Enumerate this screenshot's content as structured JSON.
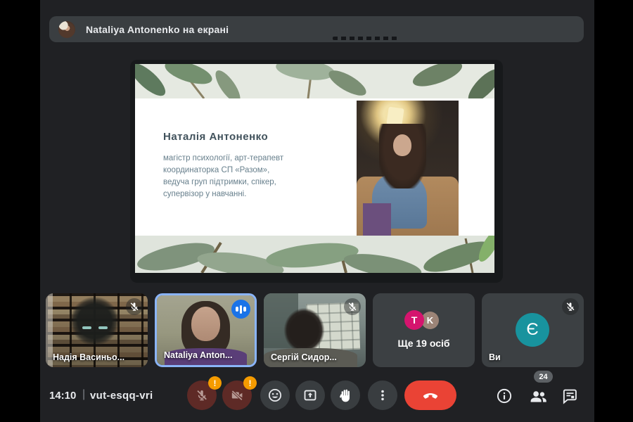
{
  "banner": {
    "text": "Nataliya Antonenko на екрані"
  },
  "slide": {
    "title": "Наталія Антоненко",
    "body_lines": [
      "магістр психології, арт-терапевт",
      "координаторка СП «Разом»,",
      "ведуча груп підтримки, спікер,",
      "супервізор у навчанні."
    ]
  },
  "tiles": [
    {
      "label": "Надія Васиньо...",
      "muted": true
    },
    {
      "label": "Nataliya Anton...",
      "active": true,
      "status": "speaking"
    },
    {
      "label": "Сергій Сидор...",
      "muted": true
    },
    {
      "label": "Ще 19 осіб",
      "avatar_letters": [
        "T",
        "K"
      ]
    },
    {
      "label": "Ви",
      "avatar_letter": "Є",
      "muted": true
    }
  ],
  "control_bar": {
    "time": "14:10",
    "separator": "|",
    "meeting_code": "vut-esqq-vri",
    "mic_alert": "!",
    "camera_alert": "!",
    "participants_count": "24"
  },
  "icons": [
    "mic-off-icon",
    "camera-off-icon",
    "emoji-icon",
    "present-screen-icon",
    "raise-hand-icon",
    "more-options-icon",
    "end-call-icon",
    "info-icon",
    "people-icon",
    "chat-icon",
    "speaking-indicator-icon"
  ],
  "colors": {
    "app_bg": "#202124",
    "surface": "#3a3e41",
    "tile_bg": "#3c4043",
    "active_tile_border": "#8ab4f8",
    "speaking_indicator": "#1a73e8",
    "end_call_red": "#ea4335",
    "muted_control_bg": "#5e2a26",
    "warning_badge": "#f59b00",
    "you_avatar_teal": "#18939e",
    "avatar_t_pink": "#d5146e",
    "avatar_k_brown": "#9c8477"
  }
}
